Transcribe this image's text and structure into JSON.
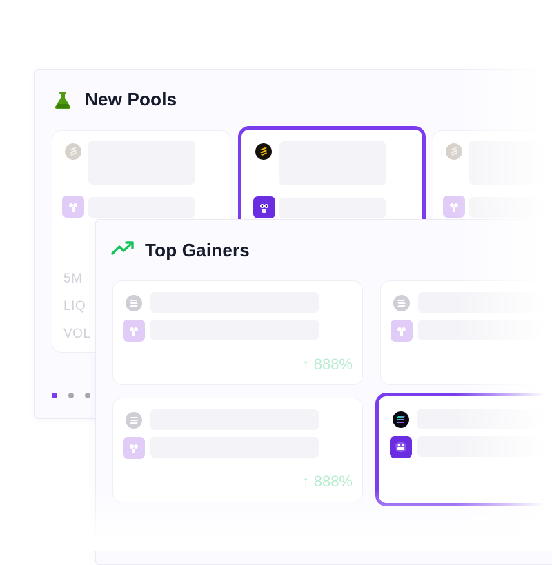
{
  "new_pools": {
    "title": "New Pools",
    "icon": "flask-icon",
    "metrics": [
      "5M",
      "LIQ",
      "VOL"
    ],
    "carousel": {
      "pages": 3,
      "active": 0
    }
  },
  "top_gainers": {
    "title": "Top Gainers",
    "icon": "trending-up-icon",
    "gains": [
      "888%",
      "888%"
    ],
    "gain_arrow": "↑"
  },
  "colors": {
    "accent": "#7a3ded",
    "title": "#151b2b",
    "gain": "#b8ecd0",
    "flask": "#4f9a11",
    "trend": "#17c45b",
    "dot_active": "#7a3ded",
    "dot_inactive": "#a7a6ad"
  },
  "icons": {
    "chain_bnb": "bnb-chain-icon",
    "chain_solana": "solana-chain-icon",
    "token": "token-avatar-icon"
  }
}
